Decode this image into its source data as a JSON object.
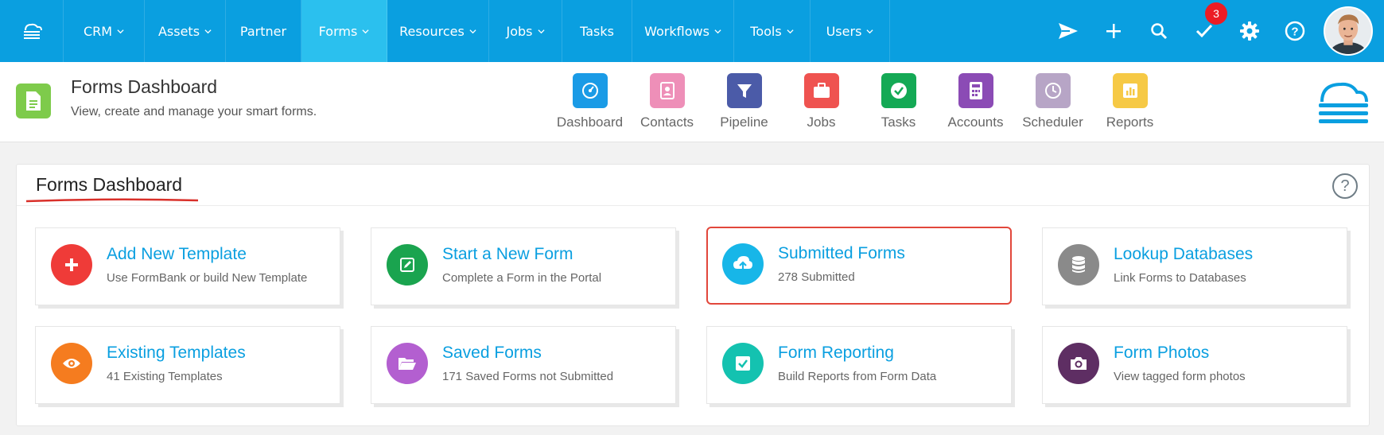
{
  "nav": {
    "menu": [
      {
        "label": "CRM",
        "has_dropdown": true,
        "active": false
      },
      {
        "label": "Assets",
        "has_dropdown": true,
        "active": false
      },
      {
        "label": "Partner",
        "has_dropdown": false,
        "active": false
      },
      {
        "label": "Forms",
        "has_dropdown": true,
        "active": true
      },
      {
        "label": "Resources",
        "has_dropdown": true,
        "active": false
      },
      {
        "label": "Jobs",
        "has_dropdown": true,
        "active": false
      },
      {
        "label": "Tasks",
        "has_dropdown": false,
        "active": false
      },
      {
        "label": "Workflows",
        "has_dropdown": true,
        "active": false
      },
      {
        "label": "Tools",
        "has_dropdown": true,
        "active": false
      },
      {
        "label": "Users",
        "has_dropdown": true,
        "active": false
      }
    ],
    "tasks_badge": "3",
    "right_icons": [
      "send-icon",
      "plus-icon",
      "search-icon",
      "checkmark-icon",
      "gear-icon",
      "help-icon"
    ]
  },
  "header": {
    "title": "Forms Dashboard",
    "subtitle": "View, create and manage your smart forms.",
    "quick_links": [
      {
        "label": "Dashboard",
        "icon": "speedometer-icon",
        "color": "#1a9be6"
      },
      {
        "label": "Contacts",
        "icon": "address-book-icon",
        "color": "#ee8fb8"
      },
      {
        "label": "Pipeline",
        "icon": "funnel-icon",
        "color": "#4b5ba8"
      },
      {
        "label": "Jobs",
        "icon": "briefcase-icon",
        "color": "#ef5350"
      },
      {
        "label": "Tasks",
        "icon": "check-circle-icon",
        "color": "#14a955"
      },
      {
        "label": "Accounts",
        "icon": "calculator-icon",
        "color": "#8b4bb5"
      },
      {
        "label": "Scheduler",
        "icon": "clock-icon",
        "color": "#b7a5c6"
      },
      {
        "label": "Reports",
        "icon": "bar-chart-icon",
        "color": "#f6c945"
      }
    ]
  },
  "panel": {
    "title": "Forms Dashboard",
    "help": "?",
    "cards": [
      {
        "title": "Add New Template",
        "subtitle": "Use FormBank or build New Template",
        "icon": "plus-icon",
        "color": "#ef3b38",
        "highlight": false
      },
      {
        "title": "Start a New Form",
        "subtitle": "Complete a Form in the Portal",
        "icon": "edit-icon",
        "color": "#1aa44f",
        "highlight": false
      },
      {
        "title": "Submitted Forms",
        "subtitle": "278 Submitted",
        "icon": "cloud-upload-icon",
        "color": "#17b6e8",
        "highlight": true
      },
      {
        "title": "Lookup Databases",
        "subtitle": "Link Forms to Databases",
        "icon": "database-icon",
        "color": "#8a8a8a",
        "highlight": false
      },
      {
        "title": "Existing Templates",
        "subtitle": "41 Existing Templates",
        "icon": "eye-icon",
        "color": "#f57c1f",
        "highlight": false
      },
      {
        "title": "Saved Forms",
        "subtitle": "171 Saved Forms not Submitted",
        "icon": "folder-open-icon",
        "color": "#b35fd0",
        "highlight": false
      },
      {
        "title": "Form Reporting",
        "subtitle": "Build Reports from Form Data",
        "icon": "checkbox-icon",
        "color": "#14c2b0",
        "highlight": false
      },
      {
        "title": "Form Photos",
        "subtitle": "View tagged form photos",
        "icon": "camera-icon",
        "color": "#5e2e63",
        "highlight": false
      }
    ]
  }
}
